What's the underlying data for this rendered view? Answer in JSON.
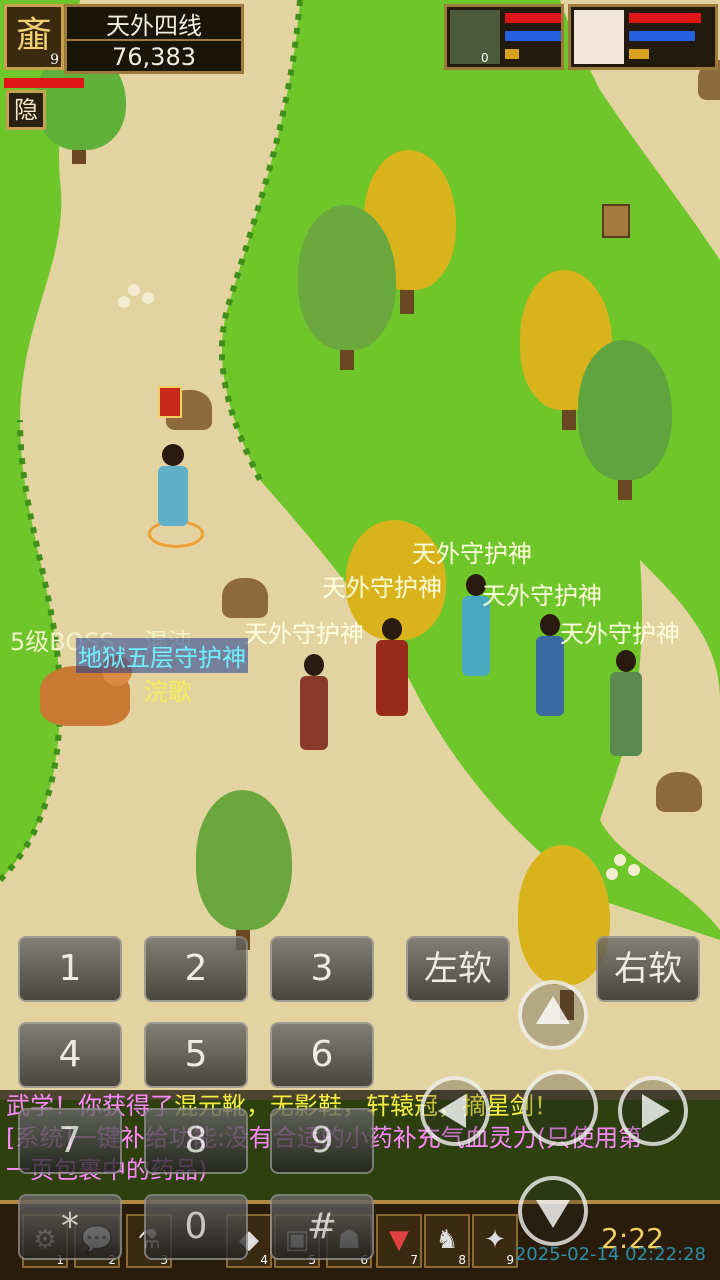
{
  "hud": {
    "server_line": "天外四线",
    "gold": "76,383",
    "badge_glyph": "齑",
    "level": "9",
    "hide_label": "隐",
    "portraits": [
      {
        "name": "pet-portrait",
        "hp": 1.0,
        "mp": 1.0,
        "level": "0"
      },
      {
        "name": "player-portrait",
        "hp": 0.95,
        "mp": 0.85
      }
    ]
  },
  "labels": {
    "guard": "天外守护神",
    "boss": "5级BOSS",
    "boss_name": "混沌",
    "hell_guard": "地狱五层守护神",
    "player_name": "浣歌"
  },
  "messages": {
    "line1_prefix": "武学！你获得了",
    "line1_items": "混元靴，无影鞋，轩辕冠，摘星剑！",
    "line2": "[系统]一键补给功能:没有合适的小药补充气血灵力(只使用第",
    "line3": "一页包裹中的药品)"
  },
  "keypad": {
    "keys": [
      "1",
      "2",
      "3",
      "4",
      "5",
      "6",
      "7",
      "8",
      "9",
      "*",
      "0",
      "#"
    ],
    "left_soft": "左软",
    "right_soft": "右软"
  },
  "bottombar": {
    "slots": [
      "1",
      "2",
      "3",
      "4",
      "5",
      "6",
      "7",
      "8",
      "9"
    ],
    "time": "2:22",
    "timestamp": "2025-02-14 02:22:28"
  },
  "colors": {
    "grass": "#6fc62a",
    "path": "#e2d3a0",
    "hp": "#e01616",
    "mp": "#2460e0",
    "msg_pink": "#ff88ff",
    "msg_yellow": "#f6ee40"
  }
}
